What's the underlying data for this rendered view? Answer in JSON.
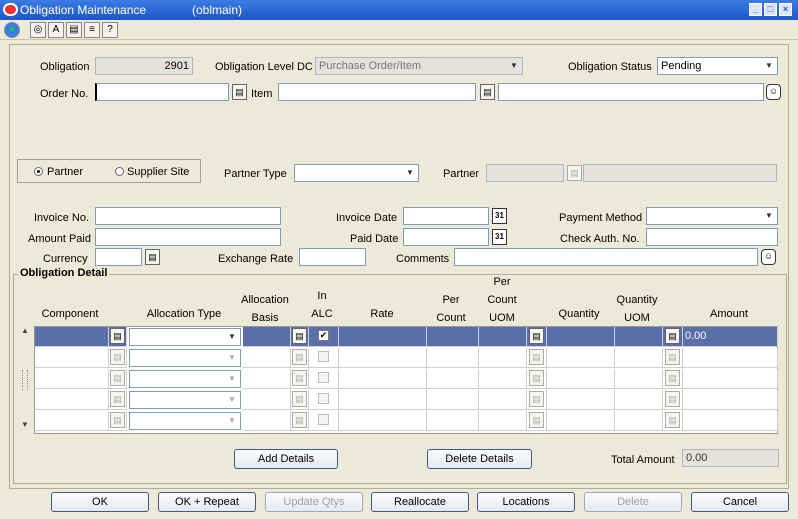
{
  "window": {
    "title": "Obligation Maintenance",
    "form_name": "(oblmain)",
    "minimize": "_",
    "maximize": "□",
    "close": "×"
  },
  "toolbar": {
    "buttons": [
      "●",
      "◎",
      "A",
      "▤",
      "≡",
      "?"
    ]
  },
  "header": {
    "obligation_label": "Obligation",
    "obligation_value": "2901",
    "level_label": "Obligation Level DC",
    "level_value": "Purchase Order/Item",
    "status_label": "Obligation Status",
    "status_value": "Pending",
    "order_label": "Order No.",
    "order_value": "",
    "item_label": "Item",
    "item_value": "",
    "item_desc": ""
  },
  "partner_section": {
    "radio_partner": "Partner",
    "radio_supplier": "Supplier Site",
    "partner_type_label": "Partner Type",
    "partner_type_value": "",
    "partner_label": "Partner",
    "partner_value": "",
    "partner_desc": ""
  },
  "invoice": {
    "invoice_no_label": "Invoice No.",
    "invoice_no_value": "",
    "invoice_date_label": "Invoice Date",
    "invoice_date_value": "",
    "payment_method_label": "Payment Method",
    "payment_method_value": "",
    "amount_paid_label": "Amount Paid",
    "amount_paid_value": "",
    "paid_date_label": "Paid Date",
    "paid_date_value": "",
    "check_auth_label": "Check Auth. No.",
    "check_auth_value": "",
    "currency_label": "Currency",
    "currency_value": "",
    "exchange_rate_label": "Exchange Rate",
    "exchange_rate_value": "",
    "comments_label": "Comments",
    "comments_value": ""
  },
  "detail": {
    "title": "Obligation Detail",
    "columns": {
      "component": "Component",
      "allocation_type": "Allocation Type",
      "allocation_basis_1": "Allocation",
      "allocation_basis_2": "Basis",
      "in_alc_1": "In",
      "in_alc_2": "ALC",
      "rate": "Rate",
      "per_count_1": "Per",
      "per_count_2": "Count",
      "per_count_uom_1": "Per",
      "per_count_uom_2": "Count",
      "per_count_uom_3": "UOM",
      "quantity": "Quantity",
      "quantity_uom_1": "Quantity",
      "quantity_uom_2": "UOM",
      "amount": "Amount"
    },
    "first_row_amount": "0.00",
    "add_details": "Add Details",
    "delete_details": "Delete Details",
    "total_amount_label": "Total Amount",
    "total_amount_value": "0.00"
  },
  "buttons": {
    "ok": "OK",
    "ok_repeat": "OK + Repeat",
    "update_qtys": "Update Qtys",
    "reallocate": "Reallocate",
    "locations": "Locations",
    "delete": "Delete",
    "cancel": "Cancel"
  },
  "colors": {
    "title_bar": "#1E55C8",
    "selected_row": "#5A6FA8",
    "background": "#ECE9D8"
  }
}
